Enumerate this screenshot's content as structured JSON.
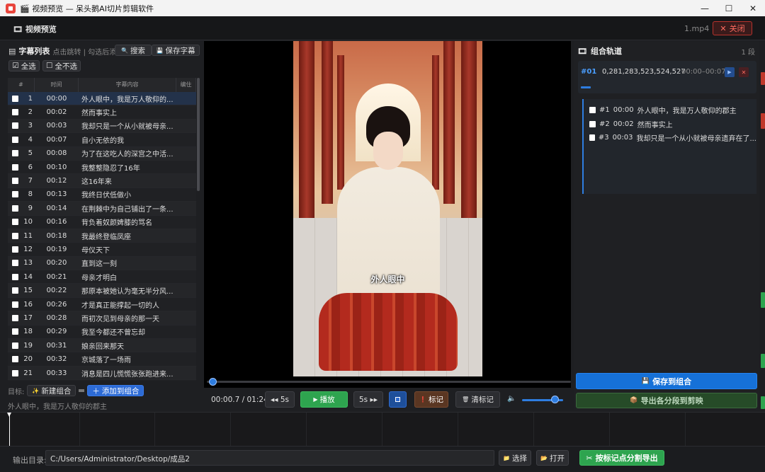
{
  "window": {
    "title": "🎬 视频预览 — 呆头鹅AI切片剪辑软件",
    "min": "—",
    "max": "☐",
    "close": "✕"
  },
  "header": {
    "icon": "🎞",
    "title": "视频预览",
    "file": "1.mp4",
    "close_label": "关闭",
    "close_icon": "✕"
  },
  "subtitles": {
    "icon": "▤",
    "title": "字幕列表",
    "hint": "点击跳转 | 勾选后添",
    "search_label": "搜索",
    "search_icon": "🔍",
    "save_label": "保存字幕",
    "save_icon": "💾",
    "select_all": "全选",
    "select_all_icon": "☑",
    "select_none": "全不选",
    "select_none_icon": "☐",
    "columns": [
      "#",
      "时间",
      "字幕内容",
      "编住"
    ],
    "rows": [
      {
        "n": "1",
        "t": "00:00",
        "text": "外人眼中，我是万人敬仰的..."
      },
      {
        "n": "2",
        "t": "00:02",
        "text": "然而事实上"
      },
      {
        "n": "3",
        "t": "00:03",
        "text": "我却只是一个从小就被母亲..."
      },
      {
        "n": "4",
        "t": "00:07",
        "text": "自小无依的我"
      },
      {
        "n": "5",
        "t": "00:08",
        "text": "为了在这吃人的深宫之中活..."
      },
      {
        "n": "6",
        "t": "00:10",
        "text": "我整整隐忍了16年"
      },
      {
        "n": "7",
        "t": "00:12",
        "text": "这16年来"
      },
      {
        "n": "8",
        "t": "00:13",
        "text": "我终日伏低做小"
      },
      {
        "n": "9",
        "t": "00:14",
        "text": "在荆棘中为自己铺出了一条..."
      },
      {
        "n": "10",
        "t": "00:16",
        "text": "背负着奴颜婢膝的骂名"
      },
      {
        "n": "11",
        "t": "00:18",
        "text": "我最终登临凤座"
      },
      {
        "n": "12",
        "t": "00:19",
        "text": "母仪天下"
      },
      {
        "n": "13",
        "t": "00:20",
        "text": "直到这一刻"
      },
      {
        "n": "14",
        "t": "00:21",
        "text": "母亲才明白"
      },
      {
        "n": "15",
        "t": "00:22",
        "text": "那原本被她认为毫无半分风..."
      },
      {
        "n": "16",
        "t": "00:26",
        "text": "才是真正能撑起一切的人"
      },
      {
        "n": "17",
        "t": "00:28",
        "text": "而初次见到母亲的那一天"
      },
      {
        "n": "18",
        "t": "00:29",
        "text": "我至今都还不曾忘却"
      },
      {
        "n": "19",
        "t": "00:31",
        "text": "娘亲回来那天"
      },
      {
        "n": "20",
        "t": "00:32",
        "text": "京城落了一场雨"
      },
      {
        "n": "21",
        "t": "00:33",
        "text": "消息是四儿慌慌张张跑进来..."
      }
    ],
    "target_label": "目标:",
    "new_group": "新建组合",
    "new_group_icon": "✨",
    "add_to_group": "添加到组合",
    "add_icon": "＋",
    "current_sub": "外人眼中，我是万人敬仰的郡主"
  },
  "player": {
    "caption": "外人眼中",
    "time": "00:00.7 / 01:24",
    "progress": 0.008,
    "back5": "◂◂ 5s",
    "play": "播放",
    "play_icon": "▶",
    "fwd5": "5s ▸▸",
    "mark": "标记",
    "mark_icon": "❗",
    "clear_marks": "清标记",
    "clear_icon": "🗑",
    "volume_icon": "🔈",
    "volume": 0.8
  },
  "groups": {
    "icon": "🎞",
    "title": "组合轨道",
    "count": "1 段",
    "card": {
      "id": "#01",
      "name": "0,281,283,523,524,527",
      "range": "00:00–00:07",
      "play": "▶",
      "delete": "✕"
    },
    "items": [
      {
        "idx": "#1",
        "t": "00:00",
        "text": "外人眼中，我是万人敬仰的郡主"
      },
      {
        "idx": "#2",
        "t": "00:02",
        "text": "然而事实上"
      },
      {
        "idx": "#3",
        "t": "00:03",
        "text": "我却只是一个从小就被母亲遗弃在了..."
      }
    ],
    "save_label": "保存到组合",
    "save_icon": "💾",
    "export_label": "导出各分段到剪映",
    "export_icon": "📦"
  },
  "footer": {
    "out_label": "输出目录:",
    "out_path": "C:/Users/Administrator/Desktop/成品2",
    "choose": "选择",
    "choose_icon": "📁",
    "open": "打开",
    "open_icon": "📂",
    "export_mark": "按标记点分割导出",
    "export_mark_icon": "✂"
  },
  "colors": {
    "accent": "#2e7de0",
    "play": "#2ea44f",
    "danger": "#ff6b60"
  }
}
